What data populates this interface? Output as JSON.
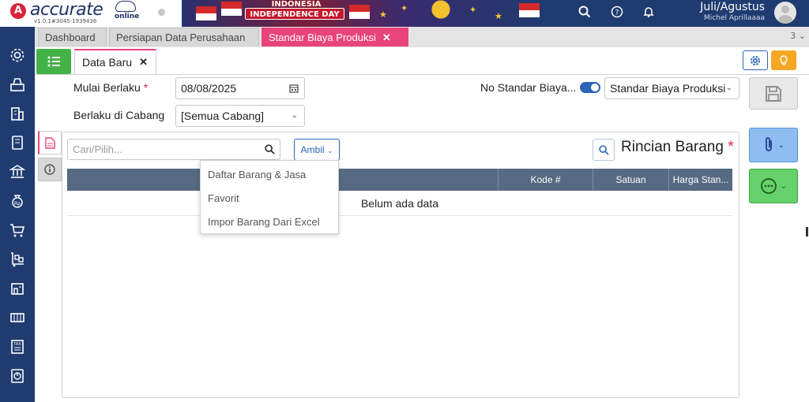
{
  "app": {
    "logo_text": "accurate",
    "logo_sub": "online",
    "version": "v1.0.1#3045-1939436"
  },
  "banner": {
    "title": "INDONESIA",
    "subtitle": "INDEPENDENCE DAY"
  },
  "user": {
    "period": "Juli/Agustus",
    "name": "Michel Aprillaaaa"
  },
  "module_tabs": [
    {
      "label": "Dashboard"
    },
    {
      "label": "Persiapan Data Perusahaan"
    },
    {
      "label": "Standar Biaya Produksi"
    }
  ],
  "tab_count": "3",
  "doc_tab": {
    "label": "Data Baru"
  },
  "form": {
    "mulai_label": "Mulai Berlaku",
    "mulai_value": "08/08/2025",
    "cabang_label": "Berlaku di Cabang",
    "cabang_value": "[Semua Cabang]",
    "no_label": "No Standar Biaya...",
    "no_value": "Standar Biaya Produksi"
  },
  "detail": {
    "search_placeholder": "Cari/Pilih...",
    "ambil_label": "Ambil",
    "title": "Rincian Barang",
    "columns": [
      "Kode #",
      "Satuan",
      "Harga Stan..."
    ],
    "empty_text": "Belum ada data",
    "dropdown_items": [
      "Daftar Barang & Jasa",
      "Favorit",
      "Impor Barang Dari Excel"
    ]
  },
  "colors": {
    "header_navy": "#1f3b70",
    "accent_pink": "#e8437a",
    "table_head": "#566a83",
    "green": "#44b347",
    "blue": "#2a64b8",
    "orange": "#f5a623"
  },
  "sidebar_icons": [
    "gear-icon",
    "inbox-tray-icon",
    "building-icon",
    "ledger-icon",
    "bank-icon",
    "money-bag-icon",
    "cart-icon",
    "trolley-icon",
    "warehouse-icon",
    "factory-icon",
    "tax-report-icon",
    "dashboard-report-icon"
  ]
}
